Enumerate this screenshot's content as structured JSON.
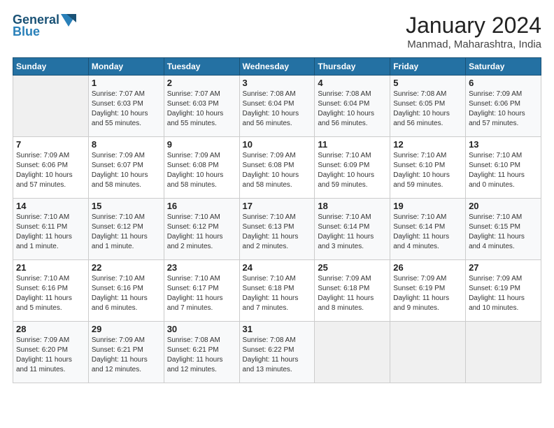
{
  "header": {
    "logo_line1": "General",
    "logo_line2": "Blue",
    "month_title": "January 2024",
    "location": "Manmad, Maharashtra, India"
  },
  "days_of_week": [
    "Sunday",
    "Monday",
    "Tuesday",
    "Wednesday",
    "Thursday",
    "Friday",
    "Saturday"
  ],
  "weeks": [
    [
      {
        "day": "",
        "info": ""
      },
      {
        "day": "1",
        "info": "Sunrise: 7:07 AM\nSunset: 6:03 PM\nDaylight: 10 hours\nand 55 minutes."
      },
      {
        "day": "2",
        "info": "Sunrise: 7:07 AM\nSunset: 6:03 PM\nDaylight: 10 hours\nand 55 minutes."
      },
      {
        "day": "3",
        "info": "Sunrise: 7:08 AM\nSunset: 6:04 PM\nDaylight: 10 hours\nand 56 minutes."
      },
      {
        "day": "4",
        "info": "Sunrise: 7:08 AM\nSunset: 6:04 PM\nDaylight: 10 hours\nand 56 minutes."
      },
      {
        "day": "5",
        "info": "Sunrise: 7:08 AM\nSunset: 6:05 PM\nDaylight: 10 hours\nand 56 minutes."
      },
      {
        "day": "6",
        "info": "Sunrise: 7:09 AM\nSunset: 6:06 PM\nDaylight: 10 hours\nand 57 minutes."
      }
    ],
    [
      {
        "day": "7",
        "info": "Sunrise: 7:09 AM\nSunset: 6:06 PM\nDaylight: 10 hours\nand 57 minutes."
      },
      {
        "day": "8",
        "info": "Sunrise: 7:09 AM\nSunset: 6:07 PM\nDaylight: 10 hours\nand 58 minutes."
      },
      {
        "day": "9",
        "info": "Sunrise: 7:09 AM\nSunset: 6:08 PM\nDaylight: 10 hours\nand 58 minutes."
      },
      {
        "day": "10",
        "info": "Sunrise: 7:09 AM\nSunset: 6:08 PM\nDaylight: 10 hours\nand 58 minutes."
      },
      {
        "day": "11",
        "info": "Sunrise: 7:10 AM\nSunset: 6:09 PM\nDaylight: 10 hours\nand 59 minutes."
      },
      {
        "day": "12",
        "info": "Sunrise: 7:10 AM\nSunset: 6:10 PM\nDaylight: 10 hours\nand 59 minutes."
      },
      {
        "day": "13",
        "info": "Sunrise: 7:10 AM\nSunset: 6:10 PM\nDaylight: 11 hours\nand 0 minutes."
      }
    ],
    [
      {
        "day": "14",
        "info": "Sunrise: 7:10 AM\nSunset: 6:11 PM\nDaylight: 11 hours\nand 1 minute."
      },
      {
        "day": "15",
        "info": "Sunrise: 7:10 AM\nSunset: 6:12 PM\nDaylight: 11 hours\nand 1 minute."
      },
      {
        "day": "16",
        "info": "Sunrise: 7:10 AM\nSunset: 6:12 PM\nDaylight: 11 hours\nand 2 minutes."
      },
      {
        "day": "17",
        "info": "Sunrise: 7:10 AM\nSunset: 6:13 PM\nDaylight: 11 hours\nand 2 minutes."
      },
      {
        "day": "18",
        "info": "Sunrise: 7:10 AM\nSunset: 6:14 PM\nDaylight: 11 hours\nand 3 minutes."
      },
      {
        "day": "19",
        "info": "Sunrise: 7:10 AM\nSunset: 6:14 PM\nDaylight: 11 hours\nand 4 minutes."
      },
      {
        "day": "20",
        "info": "Sunrise: 7:10 AM\nSunset: 6:15 PM\nDaylight: 11 hours\nand 4 minutes."
      }
    ],
    [
      {
        "day": "21",
        "info": "Sunrise: 7:10 AM\nSunset: 6:16 PM\nDaylight: 11 hours\nand 5 minutes."
      },
      {
        "day": "22",
        "info": "Sunrise: 7:10 AM\nSunset: 6:16 PM\nDaylight: 11 hours\nand 6 minutes."
      },
      {
        "day": "23",
        "info": "Sunrise: 7:10 AM\nSunset: 6:17 PM\nDaylight: 11 hours\nand 7 minutes."
      },
      {
        "day": "24",
        "info": "Sunrise: 7:10 AM\nSunset: 6:18 PM\nDaylight: 11 hours\nand 7 minutes."
      },
      {
        "day": "25",
        "info": "Sunrise: 7:09 AM\nSunset: 6:18 PM\nDaylight: 11 hours\nand 8 minutes."
      },
      {
        "day": "26",
        "info": "Sunrise: 7:09 AM\nSunset: 6:19 PM\nDaylight: 11 hours\nand 9 minutes."
      },
      {
        "day": "27",
        "info": "Sunrise: 7:09 AM\nSunset: 6:19 PM\nDaylight: 11 hours\nand 10 minutes."
      }
    ],
    [
      {
        "day": "28",
        "info": "Sunrise: 7:09 AM\nSunset: 6:20 PM\nDaylight: 11 hours\nand 11 minutes."
      },
      {
        "day": "29",
        "info": "Sunrise: 7:09 AM\nSunset: 6:21 PM\nDaylight: 11 hours\nand 12 minutes."
      },
      {
        "day": "30",
        "info": "Sunrise: 7:08 AM\nSunset: 6:21 PM\nDaylight: 11 hours\nand 12 minutes."
      },
      {
        "day": "31",
        "info": "Sunrise: 7:08 AM\nSunset: 6:22 PM\nDaylight: 11 hours\nand 13 minutes."
      },
      {
        "day": "",
        "info": ""
      },
      {
        "day": "",
        "info": ""
      },
      {
        "day": "",
        "info": ""
      }
    ]
  ]
}
